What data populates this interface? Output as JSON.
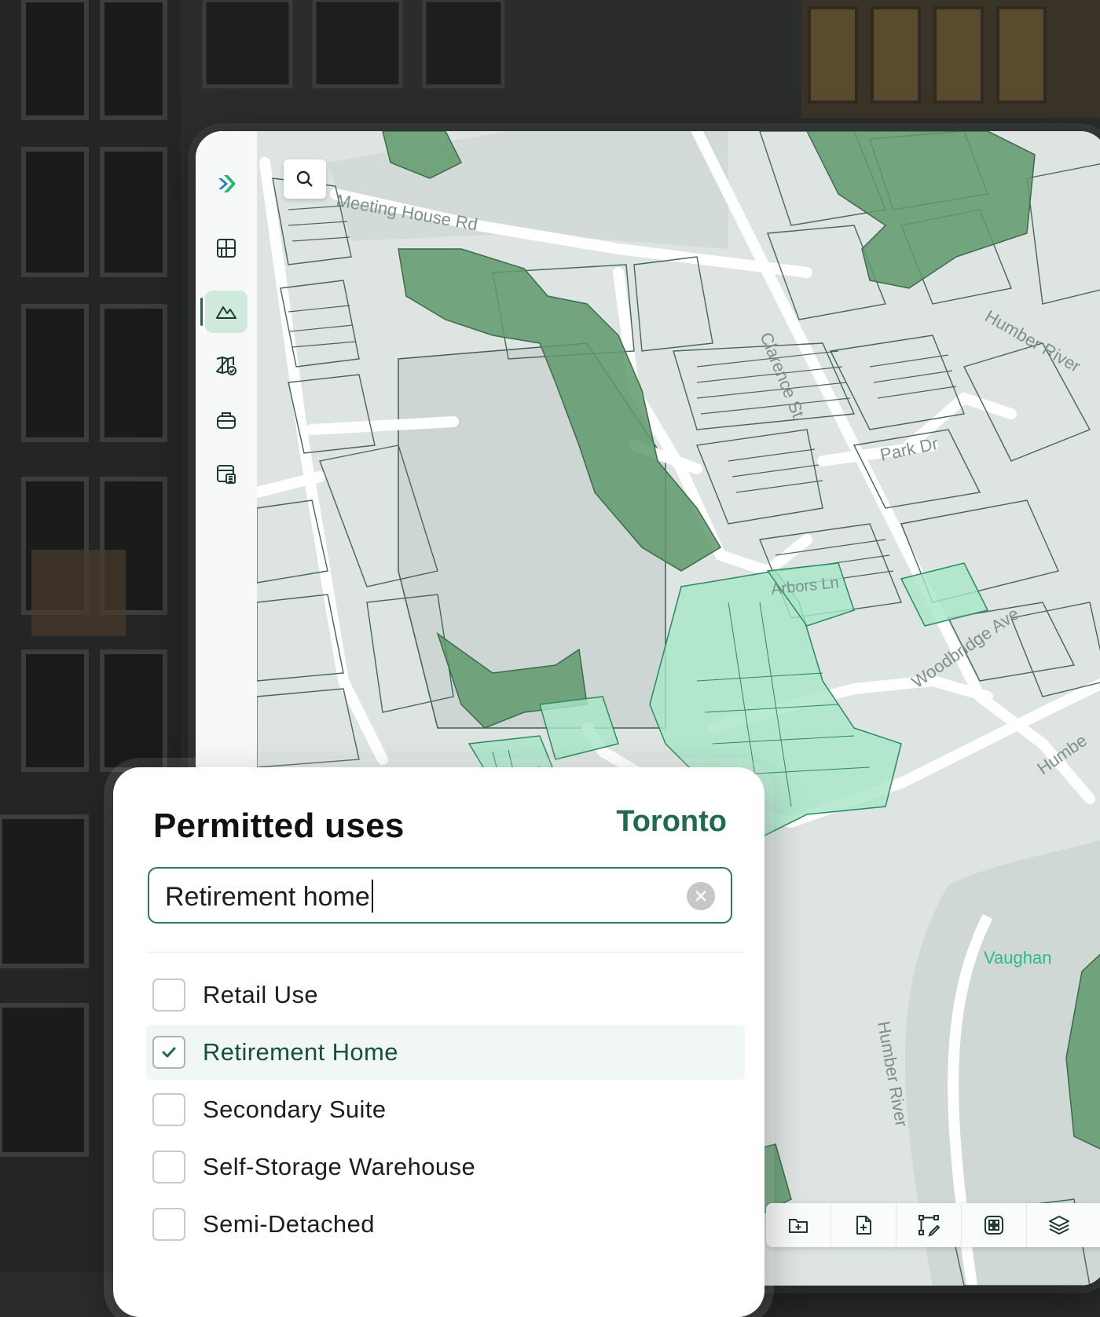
{
  "panel": {
    "title": "Permitted uses",
    "city": "Toronto",
    "search_value": "Retirement home",
    "options": [
      {
        "label": "Retail Use",
        "checked": false
      },
      {
        "label": "Retirement Home",
        "checked": true
      },
      {
        "label": "Secondary Suite",
        "checked": false
      },
      {
        "label": "Self-Storage Warehouse",
        "checked": false
      },
      {
        "label": "Semi-Detached",
        "checked": false
      }
    ]
  },
  "map": {
    "labels": {
      "meeting_house": "Meeting House Rd",
      "clarence": "Clarence St",
      "humber_river_1": "Humber River",
      "park_dr": "Park Dr",
      "arbors": "Arbors Ln",
      "woodbridge": "Woodbridge Ave",
      "humber_2": "Humbe",
      "vaughan": "Vaughan",
      "humber_river_3": "Humber River"
    }
  },
  "sidebar": {
    "icons": [
      "logo-icon",
      "grid-icon",
      "terrain-icon",
      "map-check-icon",
      "briefcase-icon",
      "calculator-icon"
    ],
    "active": "terrain-icon"
  },
  "toolbar": {
    "icons": [
      "folder-add-icon",
      "file-add-icon",
      "polygon-draw-icon",
      "select-area-icon",
      "layers-icon"
    ]
  },
  "colors": {
    "accent": "#1f6b4c",
    "park_dark": "#5f9a6c",
    "zone_light": "#a8e6c8"
  }
}
